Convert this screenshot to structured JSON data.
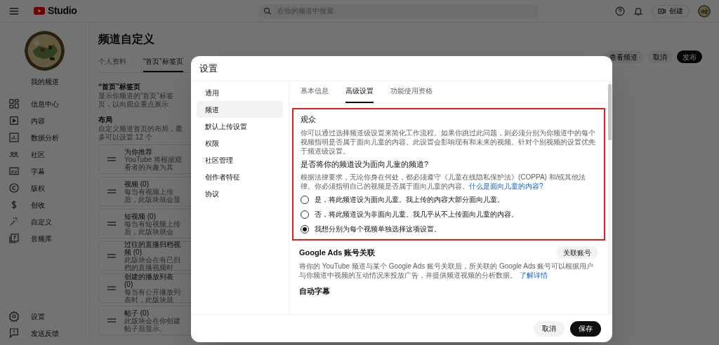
{
  "header": {
    "logo_text": "Studio",
    "search": {
      "placeholder": "在你的频道中搜索"
    },
    "create_button": "创建"
  },
  "sidebar": {
    "channel_name": "我的频道",
    "items": [
      {
        "label": "信息中心"
      },
      {
        "label": "内容"
      },
      {
        "label": "数据分析"
      },
      {
        "label": "社区"
      },
      {
        "label": "字幕"
      },
      {
        "label": "版权"
      },
      {
        "label": "创收"
      },
      {
        "label": "自定义"
      },
      {
        "label": "音频库"
      }
    ],
    "bottom_items": [
      {
        "label": "设置"
      },
      {
        "label": "发送反馈"
      }
    ]
  },
  "page": {
    "title": "频道自定义",
    "tabs": [
      {
        "label": "个人资料",
        "selected": false
      },
      {
        "label": "“首页”标签页",
        "selected": true
      }
    ],
    "buttons": [
      {
        "label": "查看频道",
        "kind": "secondary"
      },
      {
        "label": "取消",
        "kind": "secondary"
      },
      {
        "label": "发布",
        "kind": "primary"
      }
    ],
    "section": {
      "title": "“首页”标签页",
      "description": "显示你频道的“首页”标签页，以向观众重点展示"
    },
    "layout": {
      "title": "布局",
      "description": "自定义频道首页的布局，最多可以设置 12 个",
      "blocks": [
        {
          "title": "为你推荐",
          "description": "YouTube 将根据观看者的兴趣为其"
        },
        {
          "title": "视频 (0)",
          "description": "每当有视频上传后，此版块就会显"
        },
        {
          "title": "短视频 (0)",
          "description": "每当有短视频上传后，此版块就会"
        },
        {
          "title": "过往的直播归档视频 (0)",
          "description": "此版块会在有已归档的直播视频时"
        },
        {
          "title": "创建的播放列表 (0)",
          "description": "每当有公开播放列表时，此版块就"
        },
        {
          "title": "帖子 (0)",
          "description": "此版块会在你创建帖子后显示。"
        }
      ]
    }
  },
  "dialog": {
    "title": "设置",
    "nav": [
      {
        "label": "通用",
        "selected": false
      },
      {
        "label": "频道",
        "selected": true
      },
      {
        "label": "默认上传设置",
        "selected": false
      },
      {
        "label": "权限",
        "selected": false
      },
      {
        "label": "社区管理",
        "selected": false
      },
      {
        "label": "创作者特征",
        "selected": false
      },
      {
        "label": "协议",
        "selected": false
      }
    ],
    "tabs": [
      {
        "label": "基本信息",
        "selected": false
      },
      {
        "label": "高级设置",
        "selected": true
      },
      {
        "label": "功能使用资格",
        "selected": false
      }
    ],
    "audience": {
      "title": "观众",
      "description": "你可以通过选择频道级设置来简化工作流程。如果你跳过此问题，则必须分别为你频道中的每个视频指明是否属于面向儿童的内容。此设置会影响现有和未来的视频。针对个别视频的设置优先于频道级设置。",
      "question": "是否将你的频道设为面向儿童的频道?",
      "legal": "根据法律要求，无论你身在何处，都必须遵守《儿童在线隐私保护法》(COPPA) 和/或其他法律。你必须指明自己的视频是否属于面向儿童的内容。",
      "legal_link": "什么是面向儿童的内容?",
      "options": [
        {
          "label": "是，将此频道设为面向儿童。我上传的内容大部分面向儿童。",
          "selected": false
        },
        {
          "label": "否，将此频道设为非面向儿童。我几乎从不上传面向儿童的内容。",
          "selected": false
        },
        {
          "label": "我想分别为每个视频单独选择这项设置。",
          "selected": true
        }
      ]
    },
    "ads": {
      "title": "Google Ads 账号关联",
      "button": "关联账号",
      "description": "将你的 YouTube 频道与某个 Google Ads 账号关联后，所关联的 Google Ads 账号可以根据用户与你频道中视频的互动情况来投放广告，并提供频道视频的分析数据。",
      "link": "了解详情"
    },
    "next_section": "自动字幕",
    "buttons": [
      {
        "label": "取消",
        "kind": "secondary"
      },
      {
        "label": "保存",
        "kind": "primary"
      }
    ]
  }
}
